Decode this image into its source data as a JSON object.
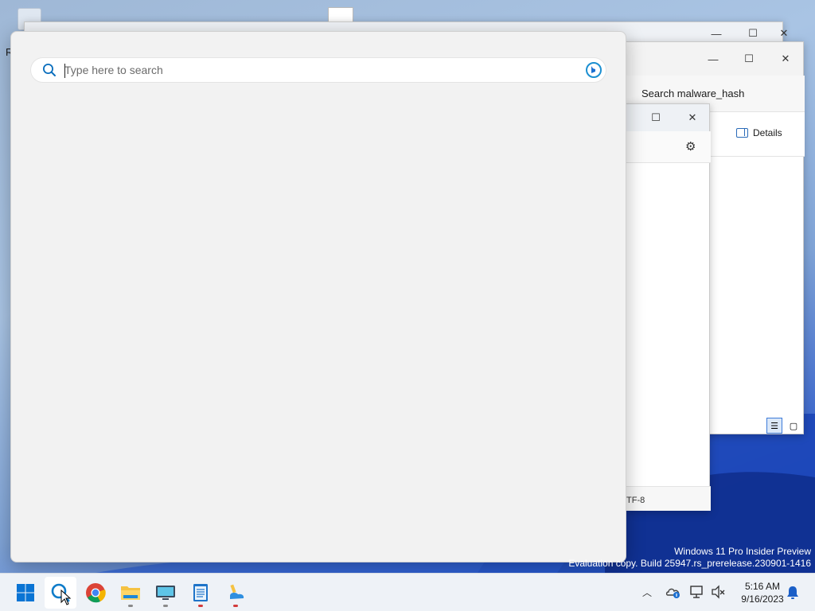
{
  "search": {
    "placeholder": "Type here to search"
  },
  "explorer_window": {
    "search_placeholder": "Search malware_hash",
    "details_label": "Details"
  },
  "notepad_window": {
    "encoding_fragment": "TF-8"
  },
  "desktop": {
    "icon_label_fragment": "R"
  },
  "watermark": {
    "line1": "Windows 11 Pro Insider Preview",
    "line2": "Evaluation copy. Build 25947.rs_prerelease.230901-1416"
  },
  "clock": {
    "time": "5:16 AM",
    "date": "9/16/2023"
  },
  "taskbar": {
    "apps": [
      "start",
      "search",
      "chrome",
      "file-explorer",
      "terminal",
      "notepad",
      "paint"
    ]
  },
  "colors": {
    "accent": "#0078d4",
    "panel_bg": "#f2f2f2",
    "taskbar_bg": "#eef2f7"
  }
}
